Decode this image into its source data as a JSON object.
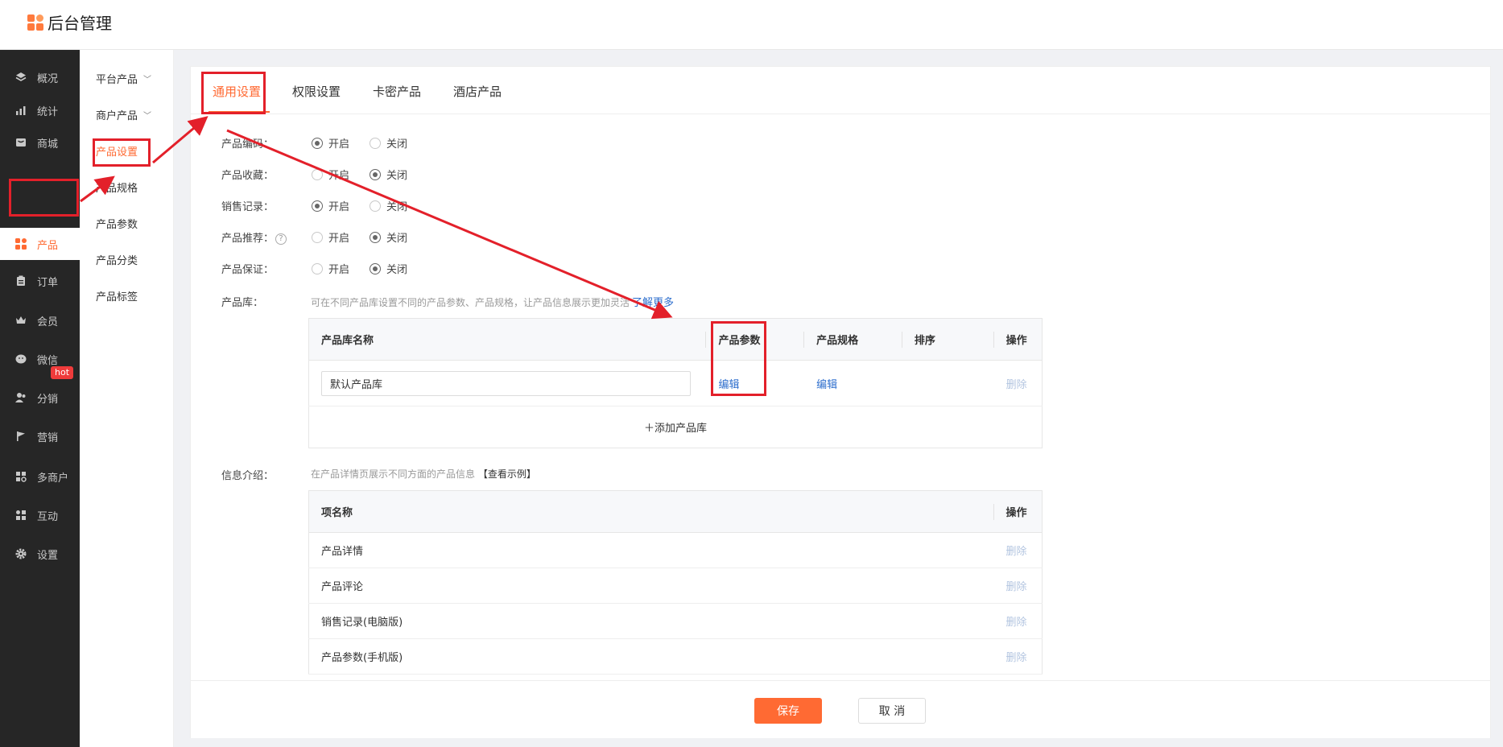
{
  "app": {
    "title": "后台管理"
  },
  "sidebar": {
    "items": [
      {
        "label": "概况",
        "icon": "layers-icon"
      },
      {
        "label": "统计",
        "icon": "chart-icon"
      },
      {
        "label": "商城",
        "icon": "store-icon"
      },
      {
        "label": "产品",
        "icon": "grid-icon",
        "active": true
      },
      {
        "label": "订单",
        "icon": "clipboard-icon"
      },
      {
        "label": "会员",
        "icon": "crown-icon"
      },
      {
        "label": "微信",
        "icon": "wechat-icon"
      },
      {
        "label": "分销",
        "icon": "users-icon"
      },
      {
        "label": "营销",
        "icon": "flag-icon",
        "badge": "hot"
      },
      {
        "label": "多商户",
        "icon": "shop-icon"
      },
      {
        "label": "互动",
        "icon": "interact-icon"
      },
      {
        "label": "设置",
        "icon": "gear-icon"
      }
    ],
    "badge": "hot"
  },
  "subnav": {
    "items": [
      {
        "label": "平台产品"
      },
      {
        "label": "商户产品"
      },
      {
        "label": "产品设置",
        "active": true
      },
      {
        "label": "产品规格"
      },
      {
        "label": "产品参数"
      },
      {
        "label": "产品分类"
      },
      {
        "label": "产品标签"
      }
    ]
  },
  "tabs": [
    {
      "label": "通用设置",
      "active": true
    },
    {
      "label": "权限设置"
    },
    {
      "label": "卡密产品"
    },
    {
      "label": "酒店产品"
    }
  ],
  "settings": [
    {
      "label": "产品编码：",
      "on_label": "开启",
      "off_label": "关闭",
      "value": "开启"
    },
    {
      "label": "产品收藏：",
      "on_label": "开启",
      "off_label": "关闭",
      "value": "关闭"
    },
    {
      "label": "销售记录：",
      "on_label": "开启",
      "off_label": "关闭",
      "value": "开启"
    },
    {
      "label": "产品推荐：",
      "on_label": "开启",
      "off_label": "关闭",
      "value": "关闭",
      "help": "?"
    },
    {
      "label": "产品保证：",
      "on_label": "开启",
      "off_label": "关闭",
      "value": "关闭"
    }
  ],
  "library": {
    "label": "产品库：",
    "hint": "可在不同产品库设置不同的产品参数、产品规格，让产品信息展示更加灵活",
    "hint_link": "了解更多",
    "columns": [
      "产品库名称",
      "产品参数",
      "产品规格",
      "排序",
      "操作"
    ],
    "rows": [
      {
        "name": "默认产品库",
        "params": "编辑",
        "specs": "编辑",
        "sort": "",
        "action": "删除"
      }
    ],
    "add_label": "添加产品库"
  },
  "info": {
    "label": "信息介绍：",
    "hint": "在产品详情页展示不同方面的产品信息",
    "hint_link": "【查看示例】",
    "columns": [
      "项名称",
      "操作"
    ],
    "rows": [
      {
        "name": "产品详情",
        "action": "删除"
      },
      {
        "name": "产品评论",
        "action": "删除"
      },
      {
        "name": "销售记录(电脑版)",
        "action": "删除"
      },
      {
        "name": "产品参数(手机版)",
        "action": "删除"
      }
    ]
  },
  "footer": {
    "save_label": "保存",
    "cancel_label": "取 消"
  },
  "colors": {
    "accent": "#ff6a33",
    "annotation": "#e3202a",
    "link": "#2d6ecd",
    "sidebar_bg": "#262626"
  }
}
